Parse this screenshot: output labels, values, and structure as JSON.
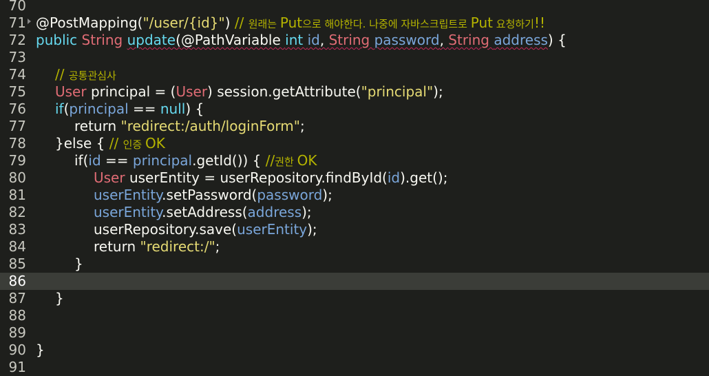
{
  "editor": {
    "lines": [
      {
        "num": "70",
        "indent": 0,
        "tokens": []
      },
      {
        "num": "71",
        "indent": 1,
        "fold": true,
        "tokens": [
          {
            "t": "@PostMapping(",
            "c": "default"
          },
          {
            "t": "\"/user/{id}\"",
            "c": "string"
          },
          {
            "t": ") ",
            "c": "default"
          },
          {
            "t": "// ",
            "c": "comment"
          },
          {
            "t": "원래는 ",
            "c": "comment small"
          },
          {
            "t": "Put",
            "c": "comment"
          },
          {
            "t": "으로 해야한다. 나중에 자바스크립트로 ",
            "c": "comment small"
          },
          {
            "t": "Put",
            "c": "comment"
          },
          {
            "t": " 요청하기",
            "c": "comment small"
          },
          {
            "t": "!!",
            "c": "comment"
          }
        ]
      },
      {
        "num": "72",
        "indent": 1,
        "tokens": [
          {
            "t": "public ",
            "c": "keyword"
          },
          {
            "t": "String ",
            "c": "type"
          },
          {
            "t": "update",
            "c": "keyword squiggle"
          },
          {
            "t": "(@PathVariable ",
            "c": "default squiggle"
          },
          {
            "t": "int ",
            "c": "keyword squiggle"
          },
          {
            "t": "id",
            "c": "param squiggle"
          },
          {
            "t": ", ",
            "c": "default squiggle"
          },
          {
            "t": "String ",
            "c": "type squiggle"
          },
          {
            "t": "password",
            "c": "param squiggle"
          },
          {
            "t": ", ",
            "c": "default squiggle"
          },
          {
            "t": "String ",
            "c": "type squiggle"
          },
          {
            "t": "address",
            "c": "param squiggle"
          },
          {
            "t": ") {",
            "c": "default"
          }
        ]
      },
      {
        "num": "73",
        "indent": 0,
        "tokens": []
      },
      {
        "num": "74",
        "indent": 2,
        "tokens": [
          {
            "t": "// ",
            "c": "comment"
          },
          {
            "t": "공통관심사",
            "c": "comment small"
          }
        ]
      },
      {
        "num": "75",
        "indent": 2,
        "tokens": [
          {
            "t": "User ",
            "c": "type"
          },
          {
            "t": "principal = (",
            "c": "default"
          },
          {
            "t": "User",
            "c": "type"
          },
          {
            "t": ") session.getAttribute(",
            "c": "default"
          },
          {
            "t": "\"principal\"",
            "c": "string"
          },
          {
            "t": ");",
            "c": "default"
          }
        ]
      },
      {
        "num": "76",
        "indent": 2,
        "tokens": [
          {
            "t": "if",
            "c": "keyword"
          },
          {
            "t": "(",
            "c": "default"
          },
          {
            "t": "principal",
            "c": "param"
          },
          {
            "t": " == ",
            "c": "default"
          },
          {
            "t": "null",
            "c": "keyword"
          },
          {
            "t": ") {",
            "c": "default"
          }
        ]
      },
      {
        "num": "77",
        "indent": 3,
        "tokens": [
          {
            "t": "return ",
            "c": "default"
          },
          {
            "t": "\"redirect:/auth/loginForm\"",
            "c": "string"
          },
          {
            "t": ";",
            "c": "default"
          }
        ]
      },
      {
        "num": "78",
        "indent": 2,
        "tokens": [
          {
            "t": "}else { ",
            "c": "default"
          },
          {
            "t": "// ",
            "c": "comment"
          },
          {
            "t": "인증 ",
            "c": "comment small"
          },
          {
            "t": "OK",
            "c": "comment"
          }
        ]
      },
      {
        "num": "79",
        "indent": 3,
        "tokens": [
          {
            "t": "if(",
            "c": "default"
          },
          {
            "t": "id",
            "c": "param"
          },
          {
            "t": " == ",
            "c": "default"
          },
          {
            "t": "principal",
            "c": "param"
          },
          {
            "t": ".getId()) { ",
            "c": "default"
          },
          {
            "t": "//",
            "c": "comment"
          },
          {
            "t": "권한 ",
            "c": "comment small"
          },
          {
            "t": "OK",
            "c": "comment"
          }
        ]
      },
      {
        "num": "80",
        "indent": 4,
        "tokens": [
          {
            "t": "User ",
            "c": "type"
          },
          {
            "t": "userEntity = userRepository.findById(",
            "c": "default"
          },
          {
            "t": "id",
            "c": "param"
          },
          {
            "t": ").get();",
            "c": "default"
          }
        ]
      },
      {
        "num": "81",
        "indent": 4,
        "tokens": [
          {
            "t": "userEntity",
            "c": "param"
          },
          {
            "t": ".setPassword(",
            "c": "default"
          },
          {
            "t": "password",
            "c": "param"
          },
          {
            "t": ");",
            "c": "default"
          }
        ]
      },
      {
        "num": "82",
        "indent": 4,
        "tokens": [
          {
            "t": "userEntity",
            "c": "param"
          },
          {
            "t": ".setAddress(",
            "c": "default"
          },
          {
            "t": "address",
            "c": "param"
          },
          {
            "t": ");",
            "c": "default"
          }
        ]
      },
      {
        "num": "83",
        "indent": 4,
        "tokens": [
          {
            "t": "userRepository.save(",
            "c": "default"
          },
          {
            "t": "userEntity",
            "c": "param"
          },
          {
            "t": ");",
            "c": "default"
          }
        ]
      },
      {
        "num": "84",
        "indent": 4,
        "tokens": [
          {
            "t": "return ",
            "c": "default"
          },
          {
            "t": "\"redirect:/\"",
            "c": "string"
          },
          {
            "t": ";",
            "c": "default"
          }
        ]
      },
      {
        "num": "85",
        "indent": 3,
        "tokens": [
          {
            "t": "}",
            "c": "default"
          }
        ]
      },
      {
        "num": "86",
        "indent": 0,
        "current": true,
        "tokens": []
      },
      {
        "num": "87",
        "indent": 2,
        "tokens": [
          {
            "t": "}",
            "c": "default"
          }
        ]
      },
      {
        "num": "88",
        "indent": 0,
        "tokens": []
      },
      {
        "num": "89",
        "indent": 0,
        "tokens": []
      },
      {
        "num": "90",
        "indent": 1,
        "tokens": [
          {
            "t": "}",
            "c": "default"
          }
        ]
      },
      {
        "num": "91",
        "indent": 0,
        "tokens": []
      }
    ]
  }
}
